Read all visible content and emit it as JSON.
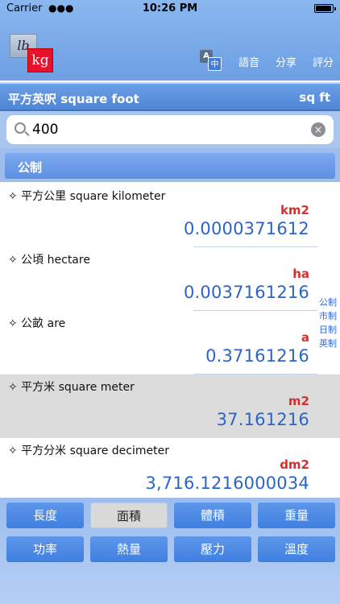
{
  "status": {
    "carrier": "Carrier",
    "time": "10:26 PM"
  },
  "logo": {
    "from": "lb",
    "to": "kg"
  },
  "nav": {
    "translate_a": "A",
    "translate_zh": "中",
    "voice": "語音",
    "share": "分享",
    "rate": "評分"
  },
  "current_unit": {
    "name": "平方英呎 square foot",
    "abbr": "sq ft"
  },
  "search": {
    "value": "400",
    "clear_glyph": "×"
  },
  "section": {
    "label": "公制"
  },
  "results": [
    {
      "title": "✧  平方公里  square kilometer",
      "abbr": "km2",
      "value": "0.0000371612"
    },
    {
      "title": "✧  公頃  hectare",
      "abbr": "ha",
      "value": "0.0037161216"
    },
    {
      "title": "✧  公畝  are",
      "abbr": "a",
      "value": "0.37161216"
    },
    {
      "title": "✧  平方米  square meter",
      "abbr": "m2",
      "value": "37.161216"
    },
    {
      "title": "✧  平方分米  square decimeter",
      "abbr": "dm2",
      "value": "3,716.1216000034"
    }
  ],
  "section_index": [
    "公制",
    "市制",
    "日制",
    "英制"
  ],
  "categories": [
    "長度",
    "面積",
    "體積",
    "重量",
    "功率",
    "熱量",
    "壓力",
    "溫度"
  ],
  "active_category": "面積",
  "colors": {
    "accent": "#2b64c8",
    "abbr": "#d2322d",
    "nav": "#6d9fe3"
  }
}
